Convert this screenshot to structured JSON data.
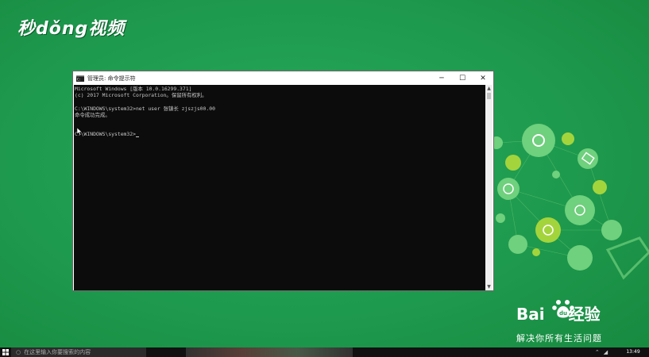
{
  "watermark": {
    "brand": "秒dǒng视频"
  },
  "window": {
    "title": "管理员: 命令提示符",
    "minimize_glyph": "─",
    "maximize_glyph": "☐",
    "close_glyph": "✕"
  },
  "console": {
    "lines": [
      "Microsoft Windows [版本 10.0.16299.371]",
      "(c) 2017 Microsoft Corporation。保留所有权利。",
      "",
      "C:\\WINDOWS\\system32>net user 张镇长 zjszjs00.00",
      "命令成功完成。",
      "",
      "",
      "C:\\WINDOWS\\system32>"
    ]
  },
  "scrollbar": {
    "up_glyph": "▲",
    "down_glyph": "▼"
  },
  "baidu": {
    "logo_left": "Bai",
    "logo_right": "经验",
    "slogan": "解决你所有生活问题"
  },
  "taskbar": {
    "search_placeholder": "在这里输入你要搜索的内容",
    "time": "13:49"
  },
  "colors": {
    "background": "#1f9a4f",
    "console_bg": "#0c0c0c",
    "console_text": "#c7c7c7"
  }
}
